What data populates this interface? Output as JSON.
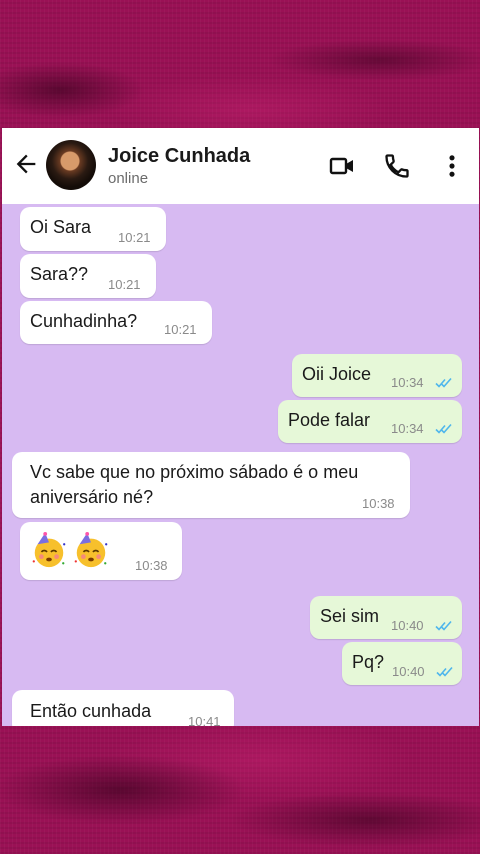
{
  "contact": {
    "name": "Joice Cunhada",
    "status": "online"
  },
  "icons": {
    "back": "arrow-left-icon",
    "video": "video-call-icon",
    "call": "phone-icon",
    "menu": "more-vert-icon",
    "emoji": "face-with-party-hat-icon",
    "read": "double-check-icon"
  },
  "colors": {
    "header_bg": "#ffffff",
    "chat_bg": "#d7baf2",
    "incoming_bubble": "#ffffff",
    "outgoing_bubble": "#e6f8d8",
    "read_ticks": "#4fb6ec"
  },
  "messages": [
    {
      "direction": "in",
      "text": "Oi Sara",
      "time": "10:21"
    },
    {
      "direction": "in",
      "text": "Sara??",
      "time": "10:21"
    },
    {
      "direction": "in",
      "text": "Cunhadinha?",
      "time": "10:21"
    },
    {
      "direction": "out",
      "text": "Oii Joice",
      "time": "10:34"
    },
    {
      "direction": "out",
      "text": "Pode falar",
      "time": "10:34"
    },
    {
      "direction": "in",
      "text_line1": "Vc sabe que no próximo sábado é o meu",
      "text_line2": "aniversário né?",
      "time": "10:38"
    },
    {
      "direction": "in",
      "emoji": "🥳🥳",
      "time": "10:38"
    },
    {
      "direction": "out",
      "text": "Sei sim",
      "time": "10:40"
    },
    {
      "direction": "out",
      "text": "Pq?",
      "time": "10:40"
    },
    {
      "direction": "in",
      "text": "Então cunhada",
      "time": "10:41"
    }
  ]
}
